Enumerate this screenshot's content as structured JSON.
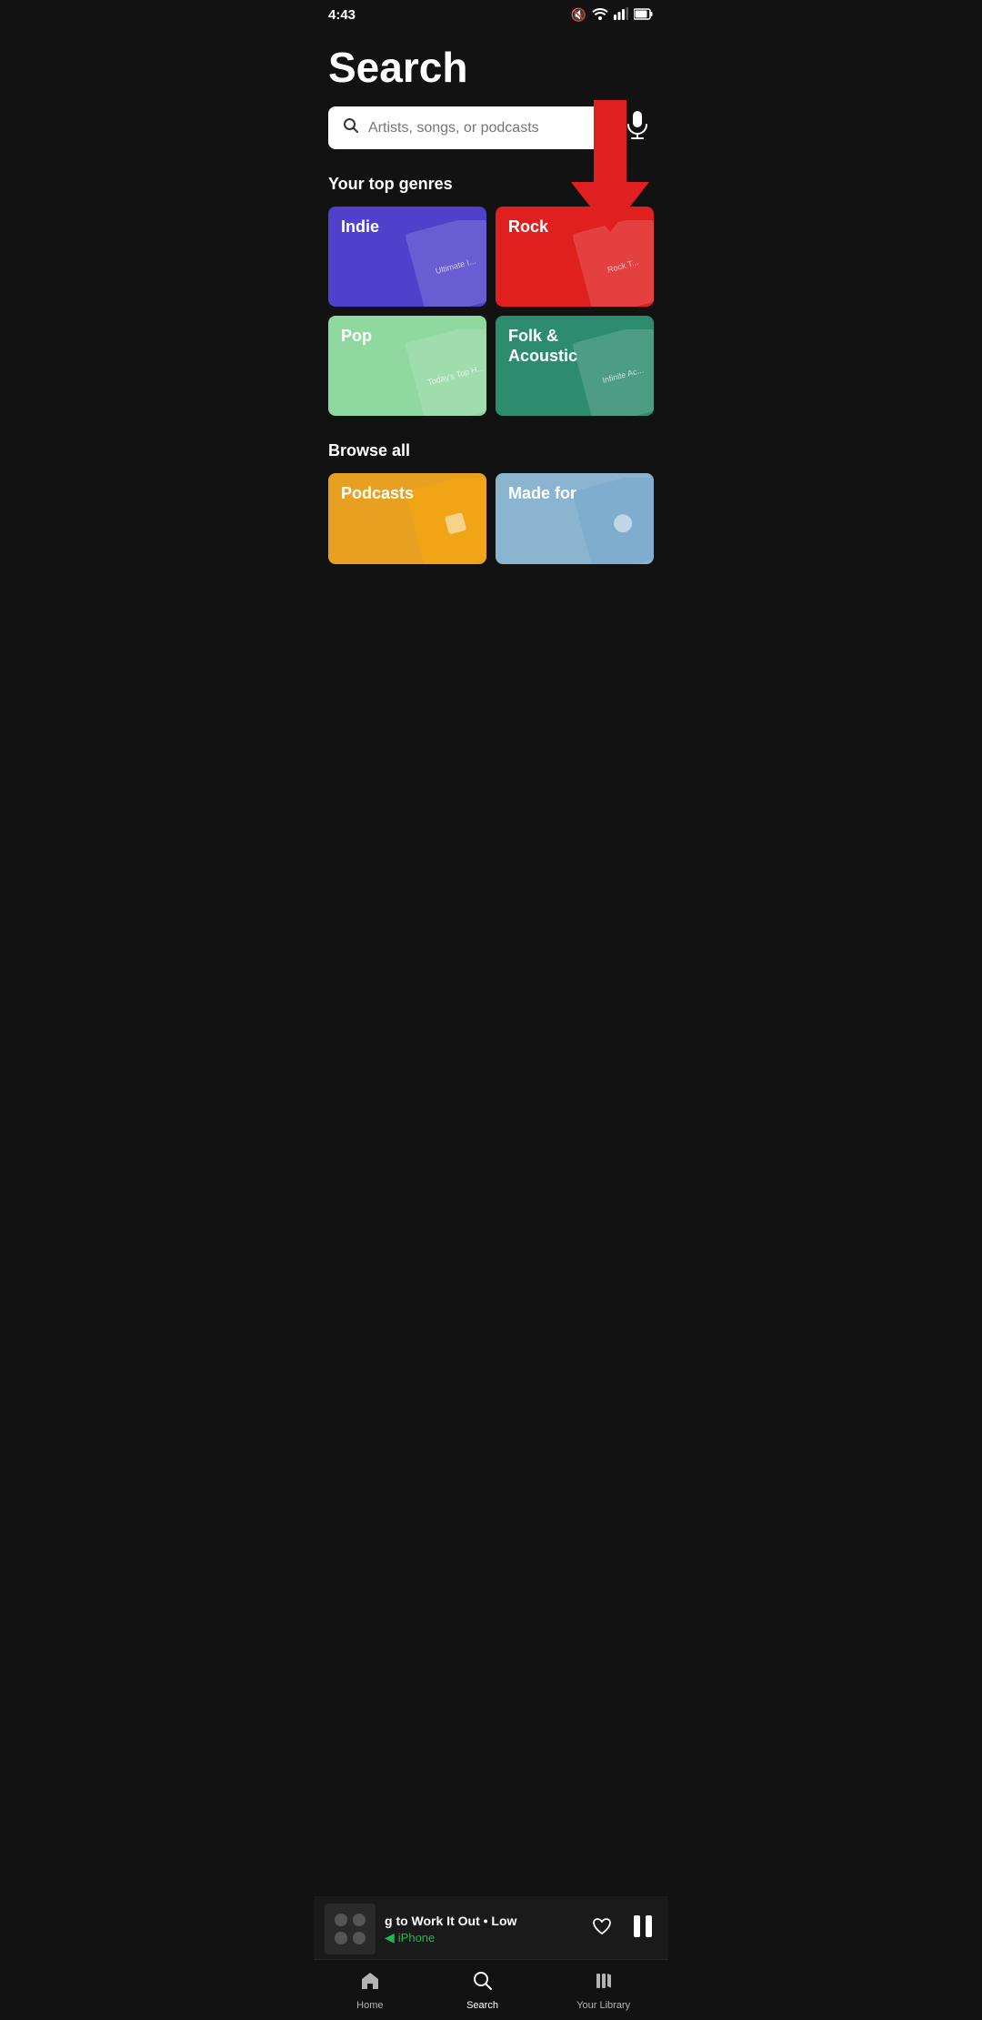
{
  "statusBar": {
    "time": "4:43",
    "muteIcon": "🔇",
    "wifiIcon": "wifi",
    "signalIcon": "signal",
    "batteryIcon": "battery"
  },
  "pageTitle": "Search",
  "searchBar": {
    "placeholder": "Artists, songs, or podcasts",
    "micLabel": "Voice search"
  },
  "topGenres": {
    "heading": "Your top genres",
    "items": [
      {
        "id": "indie",
        "label": "Indie",
        "color": "#5040cc",
        "artText": "Ultimate I..."
      },
      {
        "id": "rock",
        "label": "Rock",
        "color": "#e01f1f",
        "artText": "Rock T..."
      },
      {
        "id": "pop",
        "label": "Pop",
        "color": "#8fd8a0",
        "artText": "Today's\nTop H..."
      },
      {
        "id": "folk",
        "label": "Folk &\nAcoustic",
        "color": "#2d8c6e",
        "artText": "Infinite\nAc..."
      }
    ]
  },
  "browseAll": {
    "heading": "Browse all",
    "items": [
      {
        "id": "podcasts",
        "label": "Podcasts",
        "color": "#e8a020"
      },
      {
        "id": "made-for",
        "label": "Made for",
        "color": "#8ab4d0"
      }
    ]
  },
  "nowPlaying": {
    "title": "g to Work It Out • Low",
    "device": "iPhone",
    "deviceIcon": "◀",
    "heartLabel": "Like",
    "pauseLabel": "Pause"
  },
  "bottomNav": {
    "items": [
      {
        "id": "home",
        "label": "Home",
        "icon": "home",
        "active": false
      },
      {
        "id": "search",
        "label": "Search",
        "icon": "search",
        "active": true
      },
      {
        "id": "library",
        "label": "Your Library",
        "icon": "library",
        "active": false
      }
    ]
  }
}
